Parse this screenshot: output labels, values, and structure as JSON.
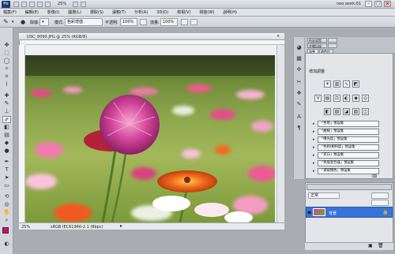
{
  "titlebar": {
    "zoom": "25%",
    "workspace": "neo work:01",
    "min": "–",
    "max": "□",
    "close": "×"
  },
  "menu": [
    "檔案(F)",
    "編輯(E)",
    "影像(I)",
    "圖層(L)",
    "選取(S)",
    "濾鏡(T)",
    "分析(A)",
    "3D(D)",
    "檢視(V)",
    "視窗(W)",
    "說明(H)"
  ],
  "options": {
    "sample_label": "取樣:",
    "mode_label": "模式:",
    "mode_value": "色彩增值",
    "opacity_label": "不透明:",
    "opacity_value": "100%",
    "flow_label": "流量:",
    "flow_value": "100%"
  },
  "document": {
    "tab_title": "DSC_8090.JPG @ 25% (RGB/8)",
    "status_zoom": "25%",
    "status_info": "sRGB IEC61966-2.1 (8bpc)"
  },
  "panels": {
    "tab_a1": "色彩導覽",
    "tab_a2": "",
    "tab_b1": "步驟記錄",
    "tab_b2": "",
    "tab_c1": "調整",
    "tab_c2": "遮色片",
    "adj_title": "增加調整",
    "presets": [
      "「色階」預設集",
      "「曲線」預設集",
      "「曝光度」預設集",
      "「色相/飽和度」預設集",
      "「黑白」預設集",
      "「色版混合器」預設集",
      "「選取顏色」預設集"
    ],
    "layer_mode": "正常",
    "layer_name": "背景"
  }
}
